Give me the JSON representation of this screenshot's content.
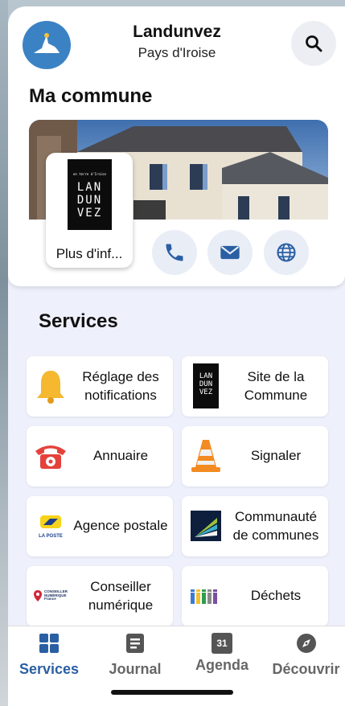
{
  "header": {
    "title": "Landunvez",
    "subtitle": "Pays d'Iroise"
  },
  "commune": {
    "section_title": "Ma commune",
    "info_label": "Plus d'inf...",
    "info_logo_lines": [
      "LAN",
      "DUN",
      "VEZ"
    ],
    "info_logo_small": "en terre d'Iroise"
  },
  "services": {
    "section_title": "Services",
    "tiles": [
      {
        "label": "Réglage des notifications",
        "icon": "bell-icon"
      },
      {
        "label": "Site de la Commune",
        "icon": "landunvez-logo-icon"
      },
      {
        "label": "Annuaire",
        "icon": "telephone-icon"
      },
      {
        "label": "Signaler",
        "icon": "traffic-cone-icon"
      },
      {
        "label": "Agence postale",
        "icon": "la-poste-icon"
      },
      {
        "label": "Communauté de communes",
        "icon": "communaute-logo-icon"
      },
      {
        "label": "Conseiller numérique",
        "icon": "conseiller-numerique-icon"
      },
      {
        "label": "Déchets",
        "icon": "waste-bins-icon"
      }
    ],
    "la_poste_text": "LA POSTE",
    "conseiller_text": "CONSEILLER NUMÉRIQUE France"
  },
  "nav": {
    "items": [
      {
        "label": "Services",
        "icon": "grid-icon",
        "active": true
      },
      {
        "label": "Journal",
        "icon": "journal-icon",
        "active": false
      },
      {
        "label": "Agenda",
        "icon": "calendar-icon",
        "active": false
      },
      {
        "label": "Découvrir",
        "icon": "compass-icon",
        "active": false
      }
    ],
    "calendar_day": "31"
  },
  "colors": {
    "accent": "#2a5fa3",
    "background": "#eef0fb"
  }
}
